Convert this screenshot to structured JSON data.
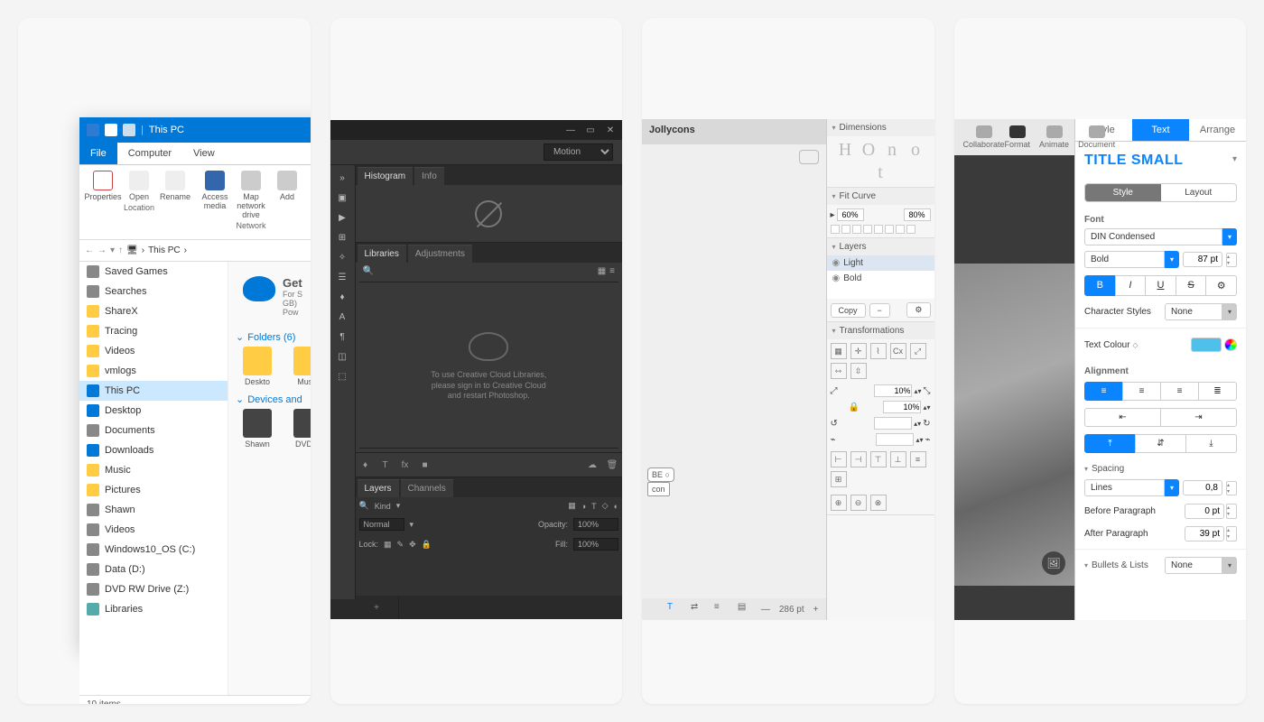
{
  "win": {
    "title": "This PC",
    "tabs": [
      "File",
      "Computer",
      "View"
    ],
    "active_tab": "File",
    "ribbon": {
      "location": [
        "Properties",
        "Open",
        "Rename"
      ],
      "network": [
        "Access media",
        "Map network drive",
        "Add"
      ],
      "group1": "Location",
      "group2": "Network"
    },
    "breadcrumb": [
      "This PC"
    ],
    "sidebar": [
      {
        "label": "Saved Games",
        "icon": "gray"
      },
      {
        "label": "Searches",
        "icon": "gray"
      },
      {
        "label": "ShareX",
        "icon": ""
      },
      {
        "label": "Tracing",
        "icon": ""
      },
      {
        "label": "Videos",
        "icon": ""
      },
      {
        "label": "vmlogs",
        "icon": ""
      },
      {
        "label": "This PC",
        "icon": "blue",
        "selected": true
      },
      {
        "label": "Desktop",
        "icon": "blue"
      },
      {
        "label": "Documents",
        "icon": "gray"
      },
      {
        "label": "Downloads",
        "icon": "blue"
      },
      {
        "label": "Music",
        "icon": ""
      },
      {
        "label": "Pictures",
        "icon": ""
      },
      {
        "label": "Shawn",
        "icon": "gray"
      },
      {
        "label": "Videos",
        "icon": "gray"
      },
      {
        "label": "Windows10_OS (C:)",
        "icon": "gray"
      },
      {
        "label": "Data (D:)",
        "icon": "gray"
      },
      {
        "label": "DVD RW Drive (Z:)",
        "icon": "gray"
      },
      {
        "label": "Libraries",
        "icon": "green"
      }
    ],
    "onedrive": {
      "head": "Get",
      "sub": "For S\nGB)\nPow"
    },
    "folders_head": "Folders (6)",
    "folders": [
      "Deskto",
      "Music"
    ],
    "devices_head": "Devices and",
    "devices": [
      "Shawn",
      "DVD R"
    ],
    "status": "10 items"
  },
  "ps": {
    "motion": "Motion",
    "tabs1": [
      "Histogram",
      "Info"
    ],
    "tabs2": [
      "Libraries",
      "Adjustments"
    ],
    "lib_msg": "To use Creative Cloud Libraries, please sign in to Creative Cloud and restart Photoshop.",
    "tabs3": [
      "Layers",
      "Channels"
    ],
    "blend": "Normal",
    "opacity_label": "Opacity:",
    "opacity": "100%",
    "lock_label": "Lock:",
    "fill_label": "Fill:",
    "fill": "100%",
    "kind": "Kind"
  },
  "gl": {
    "title": "Jollycons",
    "sec_dim": "Dimensions",
    "dim_glyphs": [
      "H",
      "O",
      "n",
      "o",
      "t"
    ],
    "sec_fit": "Fit Curve",
    "fit_a": "60%",
    "fit_b": "80%",
    "sec_layers": "Layers",
    "layers": [
      {
        "name": "Light",
        "sel": true
      },
      {
        "name": "Bold"
      }
    ],
    "copy": "Copy",
    "sec_trans": "Transformations",
    "scale_a": "10%",
    "scale_b": "10%",
    "zoom": "286 pt"
  },
  "kn": {
    "top": {
      "left": "Collaborate",
      "right": [
        "Format",
        "Animate",
        "Document"
      ]
    },
    "tabs": [
      "Style",
      "Text",
      "Arrange"
    ],
    "active_tab": "Text",
    "title": "TITLE SMALL",
    "seg": [
      "Style",
      "Layout"
    ],
    "seg_active": "Style",
    "font_label": "Font",
    "font": "DIN Condensed",
    "weight": "Bold",
    "size": "87 pt",
    "biu": [
      "B",
      "I",
      "U",
      "S",
      "⚙︎"
    ],
    "charstyles_label": "Character Styles",
    "charstyles": "None",
    "textcolor_label": "Text Colour",
    "align_label": "Alignment",
    "spacing_label": "Spacing",
    "lines_label": "Lines",
    "lines": "0,8",
    "before_label": "Before Paragraph",
    "before": "0 pt",
    "after_label": "After Paragraph",
    "after": "39 pt",
    "bullets_label": "Bullets & Lists",
    "bullets": "None"
  }
}
